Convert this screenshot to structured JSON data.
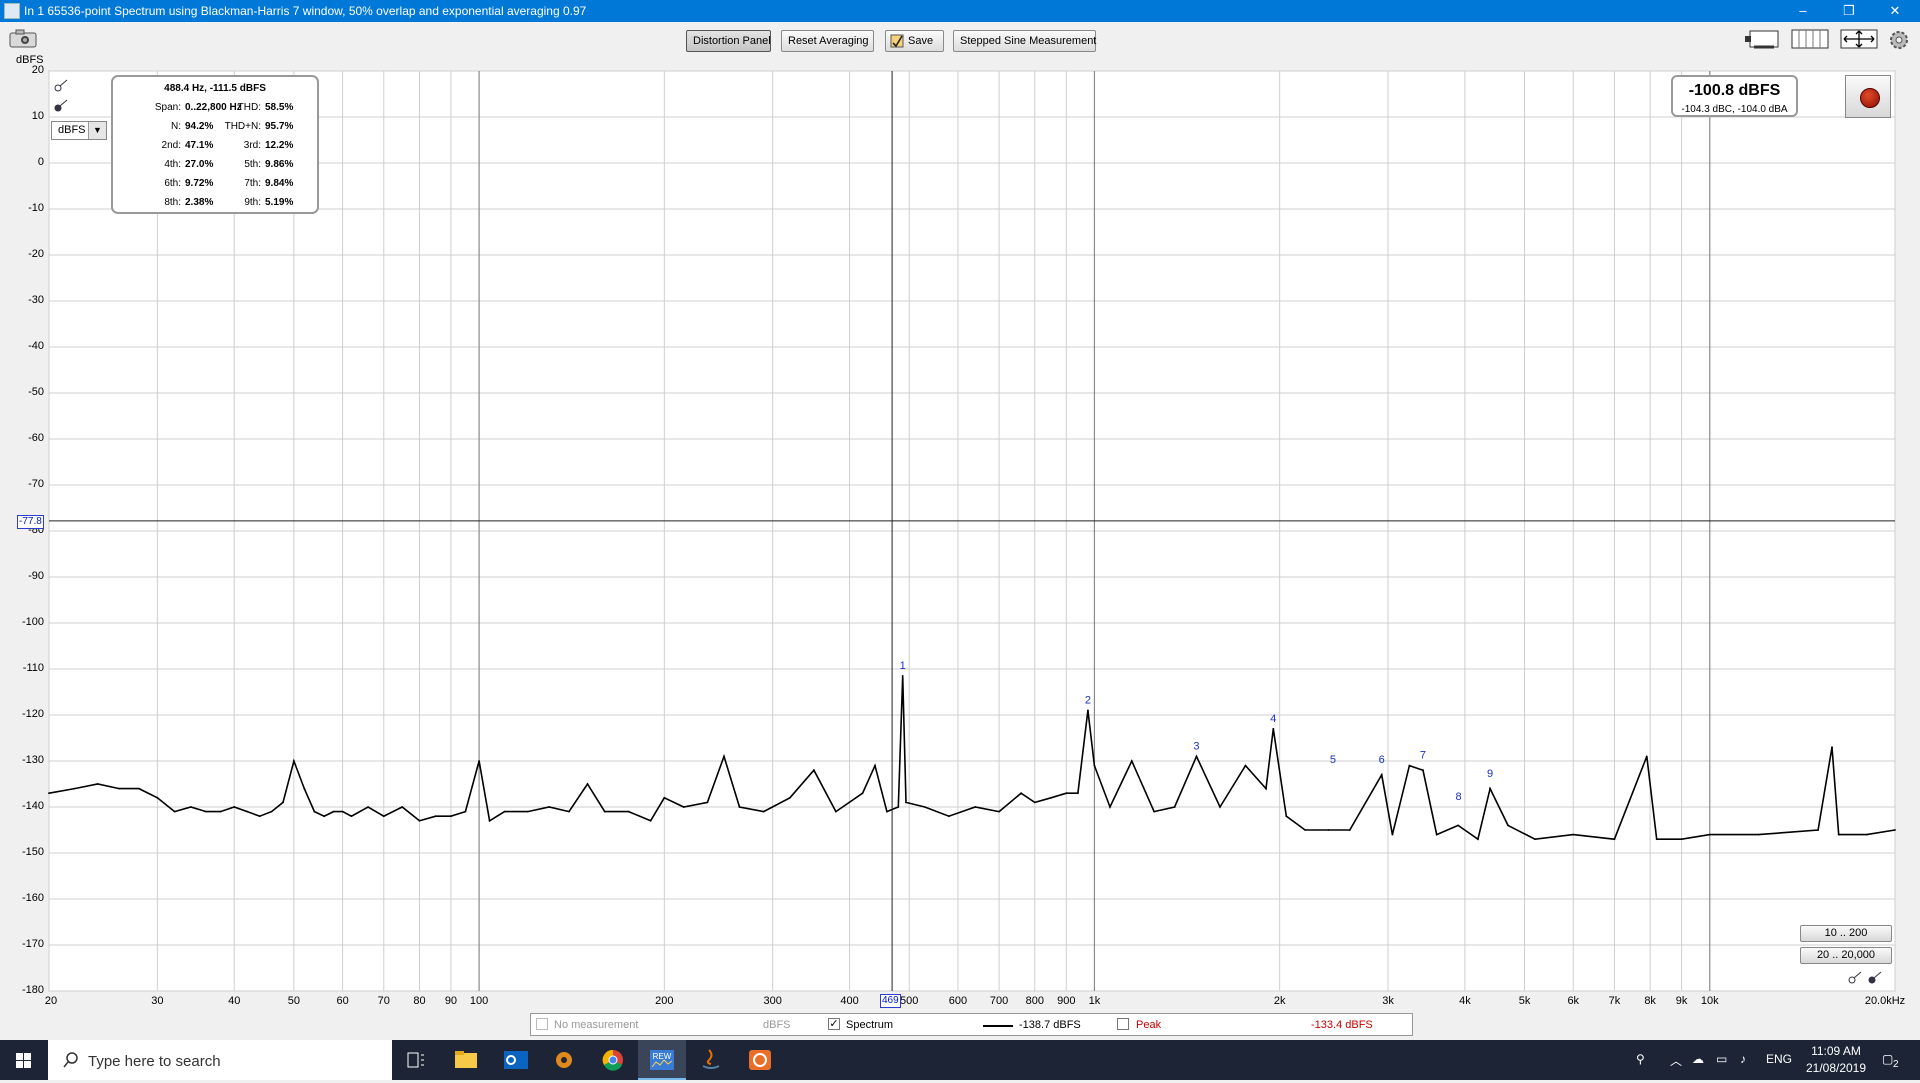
{
  "window": {
    "title": "In 1 65536-point Spectrum using Blackman-Harris 7 window, 50% overlap and exponential averaging 0.97",
    "controls": {
      "minimize": "–",
      "restore": "❐",
      "close": "✕"
    }
  },
  "toolbar": {
    "distortion_panel": "Distortion Panel",
    "reset_averaging": "Reset Averaging",
    "save": "Save",
    "stepped_sine": "Stepped Sine Measurement"
  },
  "plot": {
    "y_unit": "dBFS",
    "unit_select": "dBFS",
    "cursor_y": "-77.8",
    "cursor_x": "469",
    "range_buttons": [
      "10 .. 200",
      "20 .. 20,000"
    ],
    "line_color": "#000000",
    "grid_color": "#cfcfcf",
    "marker_color": "#1a2fc9"
  },
  "distortion": {
    "header": "488.4 Hz, -111.5 dBFS",
    "rows": [
      {
        "l1": "Span:",
        "v1": "0..22,800 Hz",
        "l2": "THD:",
        "v2": "58.5%"
      },
      {
        "l1": "N:",
        "v1": "94.2%",
        "l2": "THD+N:",
        "v2": "95.7%"
      },
      {
        "l1": "2nd:",
        "v1": "47.1%",
        "l2": "3rd:",
        "v2": "12.2%"
      },
      {
        "l1": "4th:",
        "v1": "27.0%",
        "l2": "5th:",
        "v2": "9.86%"
      },
      {
        "l1": "6th:",
        "v1": "9.72%",
        "l2": "7th:",
        "v2": "9.84%"
      },
      {
        "l1": "8th:",
        "v1": "2.38%",
        "l2": "9th:",
        "v2": "5.19%"
      }
    ]
  },
  "level": {
    "main": "-100.8 dBFS",
    "sub": "-104.3 dBC, -104.0 dBA"
  },
  "legend": {
    "no_measurement": "No measurement",
    "no_measurement_unit": "dBFS",
    "spectrum": "Spectrum",
    "spectrum_value": "-138.7 dBFS",
    "peak": "Peak",
    "peak_value": "-133.4 dBFS",
    "peak_color": "#cc0000"
  },
  "taskbar": {
    "search_placeholder": "Type here to search",
    "rew_label": "REW",
    "language": "ENG",
    "time": "11:09 AM",
    "date": "21/08/2019",
    "notifications": "2"
  },
  "chart_data": {
    "type": "line",
    "title": "",
    "xlabel": "",
    "ylabel": "dBFS",
    "x_scale": "log",
    "xlim": [
      20,
      20000
    ],
    "ylim": [
      -180,
      20
    ],
    "y_ticks": [
      20,
      10,
      0,
      -10,
      -20,
      -30,
      -40,
      -50,
      -60,
      -70,
      -80,
      -90,
      -100,
      -110,
      -120,
      -130,
      -140,
      -150,
      -160,
      -170,
      -180
    ],
    "x_ticks": [
      {
        "v": 20,
        "t": "20"
      },
      {
        "v": 30,
        "t": "30"
      },
      {
        "v": 40,
        "t": "40"
      },
      {
        "v": 50,
        "t": "50"
      },
      {
        "v": 60,
        "t": "60"
      },
      {
        "v": 70,
        "t": "70"
      },
      {
        "v": 80,
        "t": "80"
      },
      {
        "v": 90,
        "t": "90"
      },
      {
        "v": 100,
        "t": "100"
      },
      {
        "v": 200,
        "t": "200"
      },
      {
        "v": 300,
        "t": "300"
      },
      {
        "v": 400,
        "t": "400"
      },
      {
        "v": 500,
        "t": "500"
      },
      {
        "v": 600,
        "t": "600"
      },
      {
        "v": 700,
        "t": "700"
      },
      {
        "v": 800,
        "t": "800"
      },
      {
        "v": 900,
        "t": "900"
      },
      {
        "v": 1000,
        "t": "1k"
      },
      {
        "v": 2000,
        "t": "2k"
      },
      {
        "v": 3000,
        "t": "3k"
      },
      {
        "v": 4000,
        "t": "4k"
      },
      {
        "v": 5000,
        "t": "5k"
      },
      {
        "v": 6000,
        "t": "6k"
      },
      {
        "v": 7000,
        "t": "7k"
      },
      {
        "v": 8000,
        "t": "8k"
      },
      {
        "v": 9000,
        "t": "9k"
      },
      {
        "v": 10000,
        "t": "10k"
      },
      {
        "v": 20000,
        "t": "20.0kHz"
      }
    ],
    "grid": true,
    "cursor": {
      "x": 469,
      "y": -77.8
    },
    "series": [
      {
        "values": [
          [
            20,
            -137
          ],
          [
            22,
            -136
          ],
          [
            24,
            -135
          ],
          [
            26,
            -136
          ],
          [
            28,
            -136
          ],
          [
            30,
            -138
          ],
          [
            32,
            -141
          ],
          [
            34,
            -140
          ],
          [
            36,
            -141
          ],
          [
            38,
            -141
          ],
          [
            40,
            -140
          ],
          [
            42,
            -141
          ],
          [
            44,
            -142
          ],
          [
            46,
            -141
          ],
          [
            48,
            -139
          ],
          [
            50,
            -130
          ],
          [
            52,
            -136
          ],
          [
            54,
            -141
          ],
          [
            56,
            -142
          ],
          [
            58,
            -141
          ],
          [
            60,
            -141
          ],
          [
            62,
            -142
          ],
          [
            66,
            -140
          ],
          [
            70,
            -142
          ],
          [
            75,
            -140
          ],
          [
            80,
            -143
          ],
          [
            85,
            -142
          ],
          [
            90,
            -142
          ],
          [
            95,
            -141
          ],
          [
            100,
            -130
          ],
          [
            104,
            -143
          ],
          [
            110,
            -141
          ],
          [
            120,
            -141
          ],
          [
            130,
            -140
          ],
          [
            140,
            -141
          ],
          [
            150,
            -135
          ],
          [
            160,
            -141
          ],
          [
            175,
            -141
          ],
          [
            190,
            -143
          ],
          [
            200,
            -138
          ],
          [
            215,
            -140
          ],
          [
            235,
            -139
          ],
          [
            250,
            -129
          ],
          [
            265,
            -140
          ],
          [
            290,
            -141
          ],
          [
            320,
            -138
          ],
          [
            350,
            -132
          ],
          [
            380,
            -141
          ],
          [
            420,
            -137
          ],
          [
            440,
            -131
          ],
          [
            460,
            -141
          ],
          [
            480,
            -140
          ],
          [
            488,
            -111.5
          ],
          [
            494,
            -139
          ],
          [
            530,
            -140
          ],
          [
            580,
            -142
          ],
          [
            640,
            -140
          ],
          [
            700,
            -141
          ],
          [
            760,
            -137
          ],
          [
            800,
            -139
          ],
          [
            850,
            -138
          ],
          [
            900,
            -137
          ],
          [
            940,
            -137
          ],
          [
            976,
            -119
          ],
          [
            1000,
            -131
          ],
          [
            1060,
            -140
          ],
          [
            1150,
            -130
          ],
          [
            1250,
            -141
          ],
          [
            1350,
            -140
          ],
          [
            1465,
            -129
          ],
          [
            1600,
            -140
          ],
          [
            1760,
            -131
          ],
          [
            1900,
            -136
          ],
          [
            1953,
            -123
          ],
          [
            2050,
            -142
          ],
          [
            2200,
            -145
          ],
          [
            2400,
            -145
          ],
          [
            2600,
            -145
          ],
          [
            2930,
            -133
          ],
          [
            3050,
            -146
          ],
          [
            3250,
            -131
          ],
          [
            3420,
            -132
          ],
          [
            3600,
            -146
          ],
          [
            3900,
            -144
          ],
          [
            4200,
            -147
          ],
          [
            4395,
            -136
          ],
          [
            4700,
            -144
          ],
          [
            5200,
            -147
          ],
          [
            6000,
            -146
          ],
          [
            7000,
            -147
          ],
          [
            7900,
            -129
          ],
          [
            8200,
            -147
          ],
          [
            9000,
            -147
          ],
          [
            10000,
            -146
          ],
          [
            12000,
            -146
          ],
          [
            15000,
            -145
          ],
          [
            15800,
            -127
          ],
          [
            16200,
            -146
          ],
          [
            18000,
            -146
          ],
          [
            20000,
            -145
          ]
        ]
      }
    ],
    "markers": [
      {
        "x": 488,
        "y": -111.5,
        "label": "1"
      },
      {
        "x": 976,
        "y": -119,
        "label": "2"
      },
      {
        "x": 1465,
        "y": -129,
        "label": "3"
      },
      {
        "x": 1953,
        "y": -123,
        "label": "4"
      },
      {
        "x": 2441,
        "y": -132,
        "label": "5"
      },
      {
        "x": 2930,
        "y": -132,
        "label": "6"
      },
      {
        "x": 3418,
        "y": -131,
        "label": "7"
      },
      {
        "x": 3906,
        "y": -140,
        "label": "8"
      },
      {
        "x": 4395,
        "y": -135,
        "label": "9"
      }
    ]
  }
}
